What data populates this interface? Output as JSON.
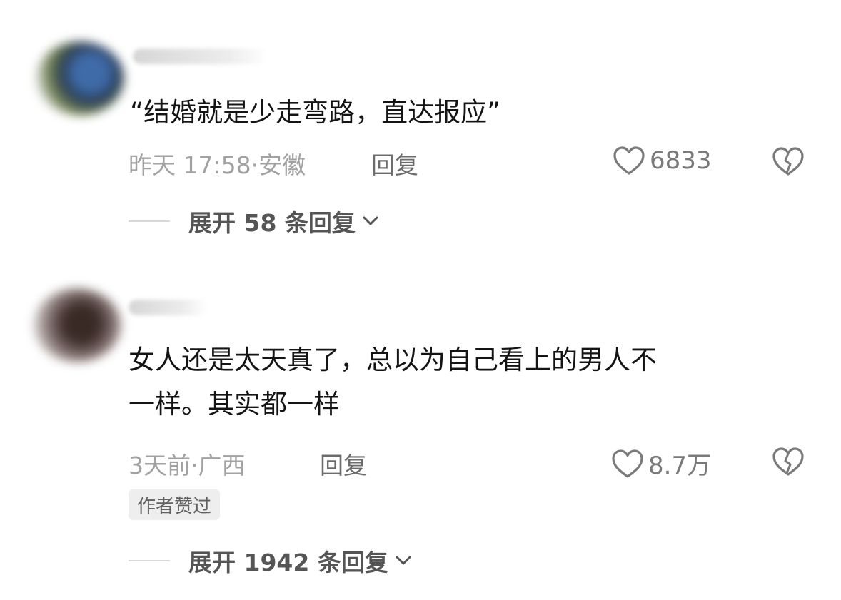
{
  "comments": [
    {
      "text_lines": [
        "“结婚就是少走弯路，直达报应”"
      ],
      "time": "昨天 17:58",
      "separator": "·",
      "location": "安徽",
      "reply_label": "回复",
      "likes": "6833",
      "expand_label": "展开 58 条回复"
    },
    {
      "text_lines": [
        "女人还是太天真了，总以为自己看上的男人不",
        "一样。其实都一样"
      ],
      "time": "3天前",
      "separator": "·",
      "location": "广西",
      "reply_label": "回复",
      "likes": "8.7万",
      "badge": "作者赞过",
      "expand_label": "展开 1942 条回复"
    }
  ],
  "icons": {
    "like": "heart-outline-icon",
    "dislike": "broken-heart-icon",
    "expand": "chevron-down-icon"
  },
  "colors": {
    "text": "#141414",
    "meta": "#a2a2a2",
    "reply": "#6c6c6c",
    "expand": "#555555",
    "icon": "#7a7a7a"
  }
}
